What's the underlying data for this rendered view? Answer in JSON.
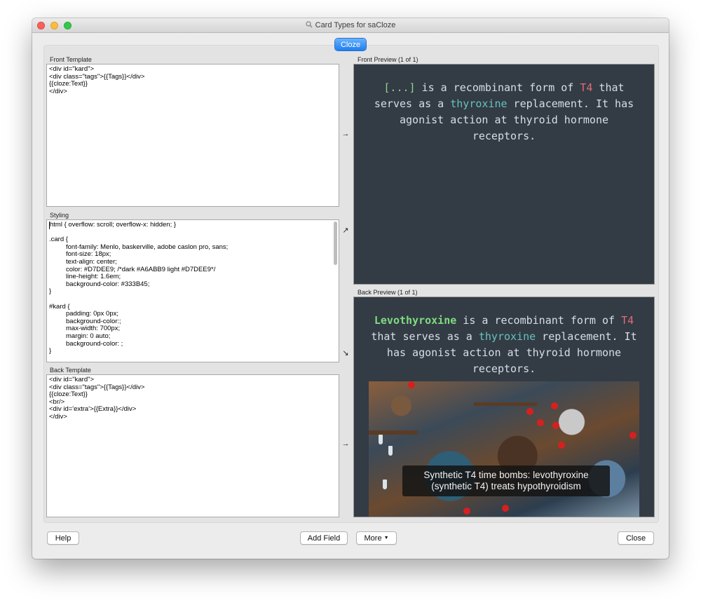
{
  "window": {
    "title": "Card Types for saCloze",
    "icon": "search-icon"
  },
  "tabs": [
    {
      "label": "Cloze",
      "selected": true
    }
  ],
  "front_template": {
    "label": "Front Template",
    "lines": [
      "<div id=\"kard\">",
      "<div class=\"tags\">{{Tags}}</div>",
      "{{cloze:Text}}",
      "</div>"
    ]
  },
  "styling": {
    "label": "Styling",
    "lines": [
      {
        "text": "html { overflow: scroll; overflow-x: hidden; }",
        "indent": false
      },
      {
        "text": "",
        "indent": false
      },
      {
        "text": ".card {",
        "indent": false
      },
      {
        "text": "font-family: Menlo, baskerville, adobe caslon pro, sans;",
        "indent": true
      },
      {
        "text": "font-size: 18px;",
        "indent": true
      },
      {
        "text": "text-align: center;",
        "indent": true
      },
      {
        "text": "color: #D7DEE9; /*dark #A6ABB9 light #D7DEE9*/",
        "indent": true
      },
      {
        "text": "line-height: 1.6em;",
        "indent": true
      },
      {
        "text": "background-color: #333B45;",
        "indent": true
      },
      {
        "text": "}",
        "indent": false
      },
      {
        "text": "",
        "indent": false
      },
      {
        "text": "#kard {",
        "indent": false
      },
      {
        "text": "padding: 0px 0px;",
        "indent": true
      },
      {
        "text": "background-color:;",
        "indent": true
      },
      {
        "text": "max-width: 700px;",
        "indent": true
      },
      {
        "text": "margin: 0 auto;",
        "indent": true
      },
      {
        "text": "background-color: ;",
        "indent": true
      },
      {
        "text": "}",
        "indent": false
      }
    ]
  },
  "back_template": {
    "label": "Back Template",
    "lines": [
      "<div id=\"kard\">",
      "<div class=\"tags\">{{Tags}}</div>",
      "{{cloze:Text}}",
      "<br/>",
      "<div id='extra'>{{Extra}}</div>",
      "</div>"
    ]
  },
  "arrows": {
    "front": "→",
    "styling_up": "↗",
    "styling_down": "↘",
    "back": "→"
  },
  "front_preview": {
    "label": "Front Preview (1 of 1)",
    "cloze": "[...]",
    "t1": " is a recombinant form of ",
    "t4": "T4",
    "t2": " that serves as a ",
    "thyroxine": "thyroxine",
    "t3": " replacement. It has agonist action at thyroid hormone receptors."
  },
  "back_preview": {
    "label": "Back Preview (1 of 1)",
    "answer": "Levothyroxine",
    "t1": " is a recombinant form of ",
    "t4": "T4",
    "t2": " that serves as a ",
    "thyroxine": "thyroxine",
    "t3": " replacement. It has agonist action at thyroid hormone receptors.",
    "image_caption_line1": "Synthetic T4 time bombs: levothyroxine",
    "image_caption_line2": "(synthetic T4) treats hypothyroidism"
  },
  "colors": {
    "card_background": "#333B45",
    "card_text": "#D7DEE9",
    "cloze_green": "#8BD48D",
    "accent_red": "#E06C75",
    "accent_teal": "#66C2BD",
    "tab_blue": "#1E7EF0"
  },
  "buttons": {
    "help": "Help",
    "add_field": "Add Field",
    "more": "More",
    "close": "Close"
  }
}
